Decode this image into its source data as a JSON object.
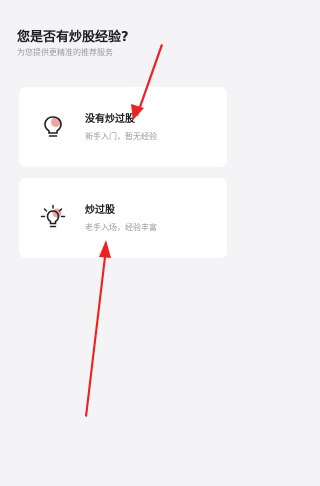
{
  "header": {
    "title": "您是否有炒股经验?",
    "subtitle": "为您提供更精准的推荐服务"
  },
  "options": [
    {
      "title": "没有炒过股",
      "description": "新手入门，暂无经验",
      "icon": "lightbulb-off-icon"
    },
    {
      "title": "炒过股",
      "description": "老手入场，经验丰富",
      "icon": "lightbulb-on-icon"
    }
  ],
  "colors": {
    "background": "#f4f4f6",
    "card": "#ffffff",
    "icon_accent": "#f4a3a3",
    "annotation_arrow": "#f02020"
  }
}
